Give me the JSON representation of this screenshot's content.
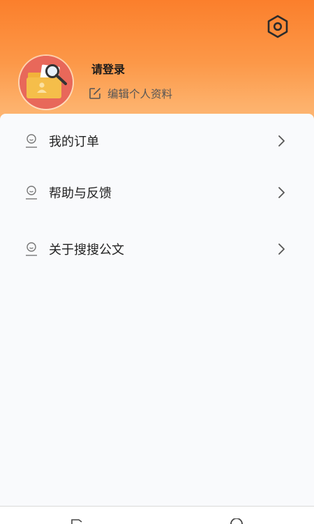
{
  "profile": {
    "login_label": "请登录",
    "edit_label": "编辑个人资料"
  },
  "menu": {
    "items": [
      {
        "label": "我的订单",
        "icon": "user-face-icon"
      },
      {
        "label": "帮助与反馈",
        "icon": "user-face-icon"
      },
      {
        "label": "关于搜搜公文",
        "icon": "user-face-icon"
      }
    ]
  },
  "colors": {
    "header_top": "#fb7f2c",
    "header_bottom": "#fdbd7e",
    "card_bg": "#f9fafc",
    "avatar_bg": "#e8685a"
  },
  "icons": {
    "settings": "hexagon-settings-icon",
    "edit": "edit-square-icon",
    "arrow": "chevron-right-icon",
    "nav_left": "document-icon",
    "nav_right": "user-icon"
  }
}
